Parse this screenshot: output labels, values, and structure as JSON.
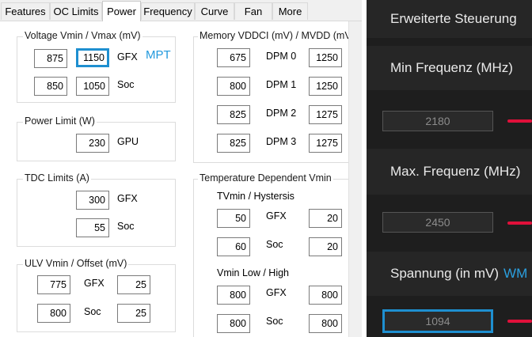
{
  "tabs": [
    "Features",
    "OC Limits",
    "Power",
    "Frequency",
    "Curve",
    "Fan",
    "More"
  ],
  "active_tab": "Power",
  "voltage": {
    "title": "Voltage Vmin / Vmax (mV)",
    "gfx_min": "875",
    "gfx_max": "1150",
    "gfx_label": "GFX",
    "soc_min": "850",
    "soc_max": "1050",
    "soc_label": "Soc",
    "mpt_tag": "MPT"
  },
  "power_limit": {
    "title": "Power Limit (W)",
    "gpu_value": "230",
    "gpu_label": "GPU"
  },
  "tdc": {
    "title": "TDC Limits (A)",
    "gfx_value": "300",
    "gfx_label": "GFX",
    "soc_value": "55",
    "soc_label": "Soc"
  },
  "ulv": {
    "title": "ULV Vmin / Offset (mV)",
    "gfx_vmin": "775",
    "gfx_label": "GFX",
    "gfx_offset": "25",
    "soc_vmin": "800",
    "soc_label": "Soc",
    "soc_offset": "25"
  },
  "memory": {
    "title": "Memory VDDCI (mV) / MVDD (mV)",
    "rows": [
      {
        "vddci": "675",
        "label": "DPM 0",
        "mvdd": "1250"
      },
      {
        "vddci": "800",
        "label": "DPM 1",
        "mvdd": "1250"
      },
      {
        "vddci": "825",
        "label": "DPM 2",
        "mvdd": "1275"
      },
      {
        "vddci": "825",
        "label": "DPM 3",
        "mvdd": "1275"
      }
    ]
  },
  "temp_vmin": {
    "title": "Temperature Dependent Vmin",
    "tvmin_title": "TVmin / Hystersis",
    "tv_gfx": "50",
    "tv_gfx_label": "GFX",
    "tv_gfx_hyst": "20",
    "tv_soc": "60",
    "tv_soc_label": "Soc",
    "tv_soc_hyst": "20",
    "vmin_title": "Vmin Low / High",
    "vm_gfx_low": "800",
    "vm_gfx_label": "GFX",
    "vm_gfx_high": "800",
    "vm_soc_low": "800",
    "vm_soc_label": "Soc",
    "vm_soc_high": "800"
  },
  "right_panel": {
    "section_title": "Erweiterte Steuerung",
    "min_freq_label": "Min Frequenz (MHz)",
    "min_freq_value": "2180",
    "max_freq_label": "Max. Frequenz (MHz)",
    "max_freq_value": "2450",
    "voltage_label": "Spannung (in mV)",
    "voltage_tag": "WM",
    "voltage_value": "1094"
  },
  "colors": {
    "highlight": "#1e8fd0",
    "slider": "#e0103a",
    "dark_bg": "#1e1e1e",
    "header_bg": "#262626"
  }
}
